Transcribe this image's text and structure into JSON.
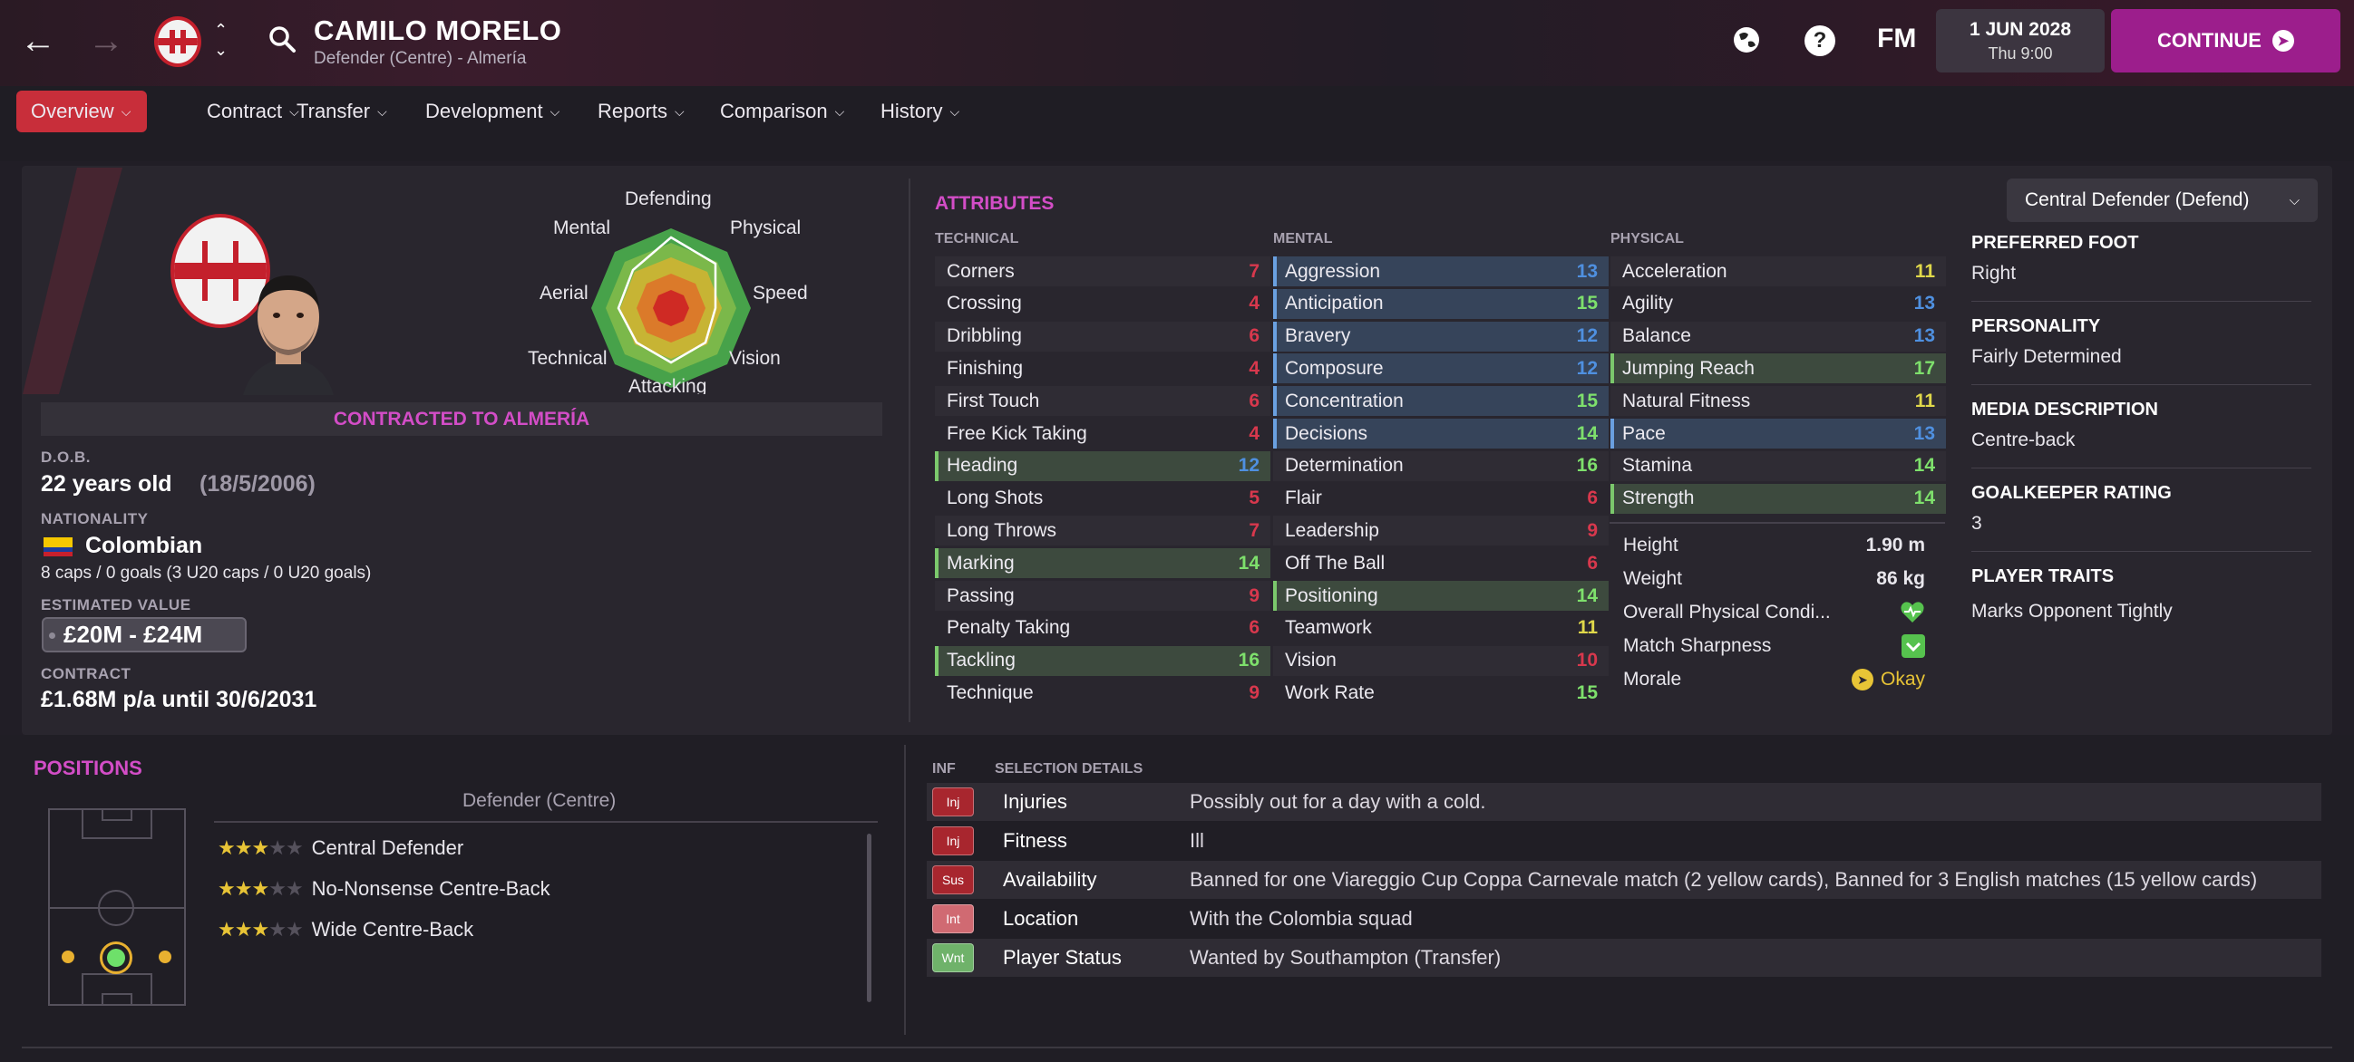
{
  "header": {
    "player_name": "CAMILO MORELO",
    "player_sub": "Defender (Centre) - Almería",
    "fm_label": "FM",
    "date": "1 JUN 2028",
    "time": "Thu 9:00",
    "continue_label": "CONTINUE"
  },
  "tabs": [
    {
      "label": "Overview"
    },
    {
      "label": "Contract"
    },
    {
      "label": "Transfer"
    },
    {
      "label": "Development"
    },
    {
      "label": "Reports"
    },
    {
      "label": "Comparison"
    },
    {
      "label": "History"
    }
  ],
  "radar": {
    "labels": [
      "Defending",
      "Physical",
      "Speed",
      "Vision",
      "Attacking",
      "Technical",
      "Aerial",
      "Mental"
    ]
  },
  "profile": {
    "contracted": "CONTRACTED TO ALMERÍA",
    "dob_label": "D.O.B.",
    "age": "22 years old",
    "dob": "(18/5/2006)",
    "nationality_label": "NATIONALITY",
    "nationality": "Colombian",
    "caps": "8 caps / 0 goals (3 U20 caps / 0 U20 goals)",
    "value_label": "ESTIMATED VALUE",
    "value": "£20M - £24M",
    "contract_label": "CONTRACT",
    "contract": "£1.68M p/a until 30/6/2031"
  },
  "attributes": {
    "title": "ATTRIBUTES",
    "technical_label": "TECHNICAL",
    "mental_label": "MENTAL",
    "physical_label": "PHYSICAL",
    "technical": [
      {
        "name": "Corners",
        "value": "7"
      },
      {
        "name": "Crossing",
        "value": "4"
      },
      {
        "name": "Dribbling",
        "value": "6"
      },
      {
        "name": "Finishing",
        "value": "4"
      },
      {
        "name": "First Touch",
        "value": "6"
      },
      {
        "name": "Free Kick Taking",
        "value": "4"
      },
      {
        "name": "Heading",
        "value": "12"
      },
      {
        "name": "Long Shots",
        "value": "5"
      },
      {
        "name": "Long Throws",
        "value": "7"
      },
      {
        "name": "Marking",
        "value": "14"
      },
      {
        "name": "Passing",
        "value": "9"
      },
      {
        "name": "Penalty Taking",
        "value": "6"
      },
      {
        "name": "Tackling",
        "value": "16"
      },
      {
        "name": "Technique",
        "value": "9"
      }
    ],
    "mental": [
      {
        "name": "Aggression",
        "value": "13"
      },
      {
        "name": "Anticipation",
        "value": "15"
      },
      {
        "name": "Bravery",
        "value": "12"
      },
      {
        "name": "Composure",
        "value": "12"
      },
      {
        "name": "Concentration",
        "value": "15"
      },
      {
        "name": "Decisions",
        "value": "14"
      },
      {
        "name": "Determination",
        "value": "16"
      },
      {
        "name": "Flair",
        "value": "6"
      },
      {
        "name": "Leadership",
        "value": "9"
      },
      {
        "name": "Off The Ball",
        "value": "6"
      },
      {
        "name": "Positioning",
        "value": "14"
      },
      {
        "name": "Teamwork",
        "value": "11"
      },
      {
        "name": "Vision",
        "value": "10"
      },
      {
        "name": "Work Rate",
        "value": "15"
      }
    ],
    "physical": [
      {
        "name": "Acceleration",
        "value": "11"
      },
      {
        "name": "Agility",
        "value": "13"
      },
      {
        "name": "Balance",
        "value": "13"
      },
      {
        "name": "Jumping Reach",
        "value": "17"
      },
      {
        "name": "Natural Fitness",
        "value": "11"
      },
      {
        "name": "Pace",
        "value": "13"
      },
      {
        "name": "Stamina",
        "value": "14"
      },
      {
        "name": "Strength",
        "value": "14"
      }
    ],
    "extra": {
      "height_label": "Height",
      "height": "1.90 m",
      "weight_label": "Weight",
      "weight": "86 kg",
      "condition_label": "Overall Physical Condi...",
      "sharpness_label": "Match Sharpness",
      "morale_label": "Morale",
      "morale": "Okay"
    }
  },
  "right": {
    "role": "Central Defender (Defend)",
    "foot_label": "PREFERRED FOOT",
    "foot": "Right",
    "personality_label": "PERSONALITY",
    "personality": "Fairly Determined",
    "media_label": "MEDIA DESCRIPTION",
    "media": "Centre-back",
    "gk_label": "GOALKEEPER RATING",
    "gk": "3",
    "traits_label": "PLAYER TRAITS",
    "traits": "Marks Opponent Tightly"
  },
  "positions": {
    "title": "POSITIONS",
    "main": "Defender (Centre)",
    "roles": [
      {
        "name": "Central Defender",
        "stars": 3
      },
      {
        "name": "No-Nonsense Centre-Back",
        "stars": 3
      },
      {
        "name": "Wide Centre-Back",
        "stars": 3
      }
    ]
  },
  "selection": {
    "inf_label": "INF",
    "title": "SELECTION DETAILS",
    "rows": [
      {
        "badge": "Inj",
        "color": "#a8262e",
        "category": "Injuries",
        "detail": "Possibly out for a day with a cold."
      },
      {
        "badge": "Inj",
        "color": "#a8262e",
        "category": "Fitness",
        "detail": "Ill"
      },
      {
        "badge": "Sus",
        "color": "#a8262e",
        "category": "Availability",
        "detail": "Banned for one Viareggio Cup Coppa Carnevale match (2 yellow cards), Banned for 3 English matches (15 yellow cards)"
      },
      {
        "badge": "Int",
        "color": "#d06a72",
        "category": "Location",
        "detail": "With the Colombia squad"
      },
      {
        "badge": "Wnt",
        "color": "#6fb26a",
        "category": "Player Status",
        "detail": "Wanted by Southampton (Transfer)"
      }
    ]
  }
}
